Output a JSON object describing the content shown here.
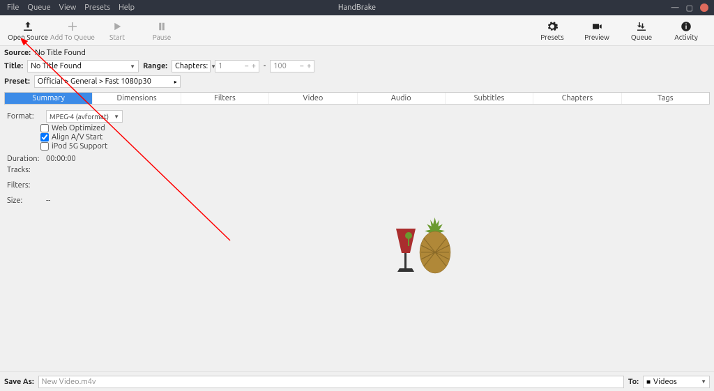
{
  "title": "HandBrake",
  "menu": [
    "File",
    "Queue",
    "View",
    "Presets",
    "Help"
  ],
  "toolbar": {
    "open_source": "Open Source",
    "add_to_queue": "Add To Queue",
    "start": "Start",
    "pause": "Pause",
    "presets": "Presets",
    "preview": "Preview",
    "queue": "Queue",
    "activity": "Activity"
  },
  "source": {
    "label": "Source:",
    "value": "No Title Found"
  },
  "titlerow": {
    "label": "Title:",
    "value": "No Title Found",
    "range_label": "Range:",
    "range_value": "Chapters:",
    "start": "1",
    "end": "100"
  },
  "preset": {
    "label": "Preset:",
    "value": "Official > General > Fast 1080p30"
  },
  "tabs": [
    "Summary",
    "Dimensions",
    "Filters",
    "Video",
    "Audio",
    "Subtitles",
    "Chapters",
    "Tags"
  ],
  "summary": {
    "format_label": "Format:",
    "format_value": "MPEG-4 (avformat)",
    "web_optimized": "Web Optimized",
    "align_av": "Align A/V Start",
    "ipod_5g": "iPod 5G Support",
    "duration_label": "Duration:",
    "duration_value": "00:00:00",
    "tracks_label": "Tracks:",
    "filters_label": "Filters:",
    "size_label": "Size:",
    "size_value": "--"
  },
  "saveas": {
    "label": "Save As:",
    "filename": "New Video.m4v",
    "to_label": "To:",
    "dest": "Videos"
  }
}
